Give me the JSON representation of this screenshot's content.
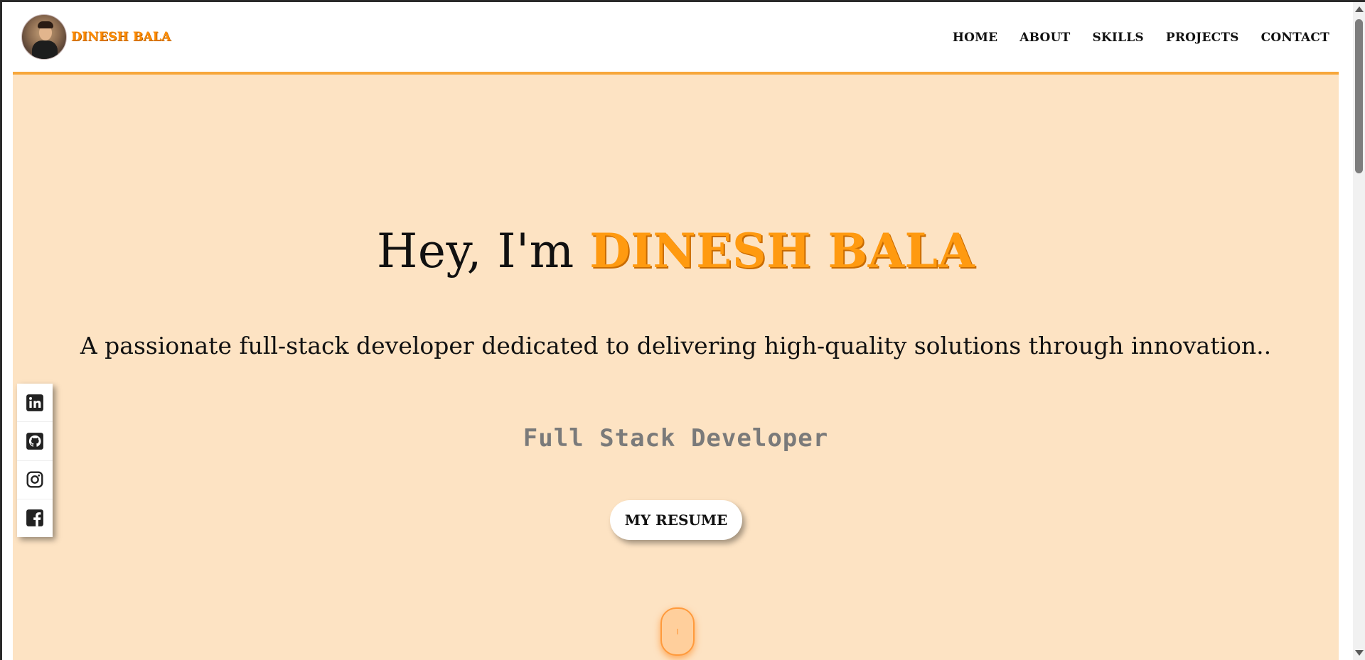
{
  "brand": {
    "name": "DINESH BALA"
  },
  "nav": {
    "items": [
      "HOME",
      "ABOUT",
      "SKILLS",
      "PROJECTS",
      "CONTACT"
    ]
  },
  "hero": {
    "greeting": "Hey, I'm ",
    "name": "DINESH BALA",
    "subtitle": "A passionate full-stack developer dedicated to delivering high-quality solutions through innovation..",
    "role": "Full Stack Developer",
    "resume_label": "MY RESUME"
  },
  "social": {
    "items": [
      "linkedin-icon",
      "github-icon",
      "instagram-icon",
      "facebook-icon"
    ]
  },
  "colors": {
    "accent": "#ff9a10",
    "hero_bg": "#fde3c3",
    "nav_border": "#f7a73b"
  }
}
